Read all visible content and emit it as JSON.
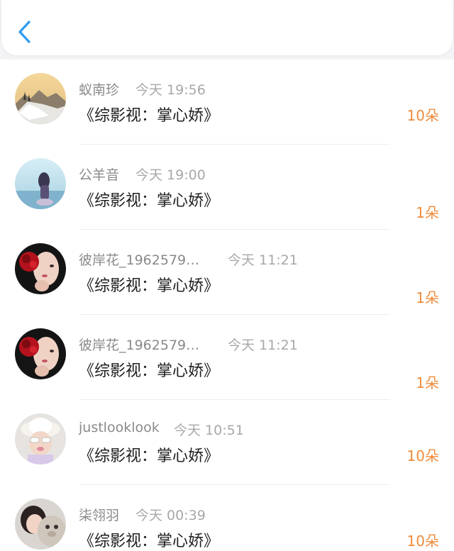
{
  "header": {
    "back_icon": "chevron-left-icon",
    "accent_color": "#2d9bf0"
  },
  "colors": {
    "count": "#f08b3a",
    "name": "#8a8a8a",
    "time": "#a8a8a8"
  },
  "items": [
    {
      "name": "蚁南珍",
      "time": "今天 19:56",
      "work": "《综影视：掌心娇》",
      "count": "10朵",
      "avatar": "snow-landscape-avatar"
    },
    {
      "name": "公羊音",
      "time": "今天 19:00",
      "work": "《综影视：掌心娇》",
      "count": "1朵",
      "avatar": "girl-by-sea-avatar"
    },
    {
      "name": "彼岸花_1962579…",
      "time": "今天 11:21",
      "work": "《综影视：掌心娇》",
      "count": "1朵",
      "avatar": "red-flower-portrait-avatar"
    },
    {
      "name": "彼岸花_1962579…",
      "time": "今天 11:21",
      "work": "《综影视：掌心娇》",
      "count": "1朵",
      "avatar": "red-flower-portrait-avatar"
    },
    {
      "name": "justlooklook",
      "time": "今天 10:51",
      "work": "《综影视：掌心娇》",
      "count": "10朵",
      "avatar": "child-with-hat-avatar"
    },
    {
      "name": "柒翎羽",
      "time": "今天 00:39",
      "work": "《综影视：掌心娇》",
      "count": "10朵",
      "avatar": "girl-with-plush-avatar"
    }
  ]
}
